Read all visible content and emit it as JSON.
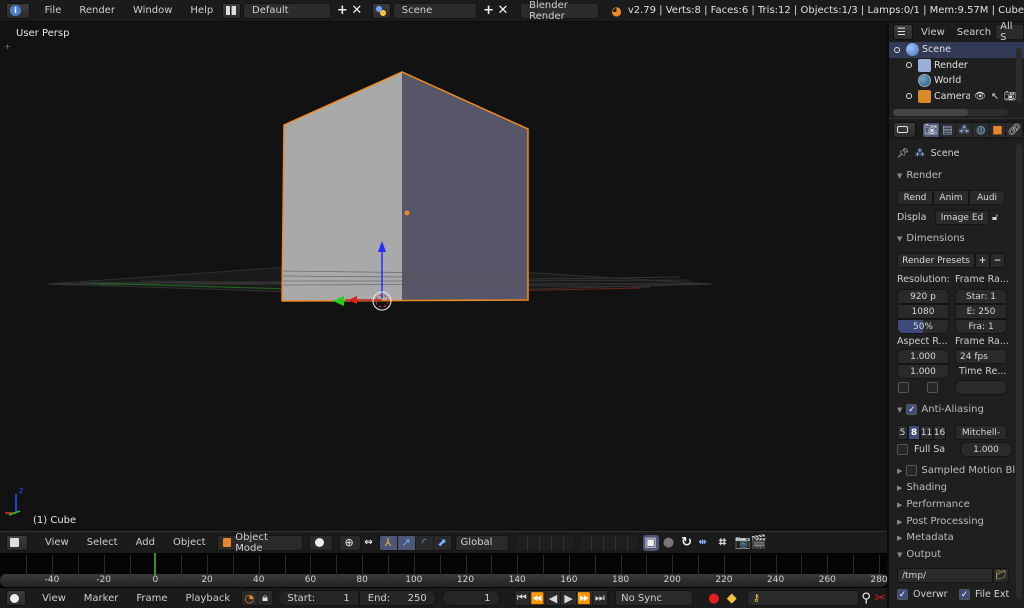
{
  "topbar": {
    "menus": [
      "File",
      "Render",
      "Window",
      "Help"
    ],
    "screen_layout": "Default",
    "scene": "Scene",
    "render_engine": "Blender Render",
    "stats": "v2.79 | Verts:8 | Faces:6 | Tris:12 | Objects:1/3 | Lamps:0/1 | Mem:9.57M | Cube"
  },
  "viewport": {
    "view_label": "User Persp",
    "object_label": "(1) Cube",
    "axis_z": "z",
    "axis_y": "y",
    "colors": {
      "selection_outline": "#f08a24",
      "background": "#121212"
    }
  },
  "view3d_header": {
    "menus": [
      "View",
      "Select",
      "Add",
      "Object"
    ],
    "mode": "Object Mode",
    "orientation": "Global"
  },
  "timeline": {
    "ticks": [
      "-40",
      "-20",
      "0",
      "20",
      "40",
      "60",
      "80",
      "100",
      "120",
      "140",
      "160",
      "180",
      "200",
      "220",
      "240",
      "260",
      "280"
    ],
    "current_frame_marker": "0",
    "menus": [
      "View",
      "Marker",
      "Frame",
      "Playback"
    ],
    "start_label": "Start:",
    "start_value": "1",
    "end_label": "End:",
    "end_value": "250",
    "current_frame": "1",
    "sync": "No Sync"
  },
  "outliner": {
    "header_menus": [
      "View",
      "Search",
      "All S"
    ],
    "items": [
      {
        "label": "Scene",
        "icon": "scene-icon",
        "selected": true
      },
      {
        "label": "Render",
        "icon": "render-layers-icon"
      },
      {
        "label": "World",
        "icon": "world-icon"
      },
      {
        "label": "Camera",
        "icon": "camera-icon"
      }
    ]
  },
  "properties": {
    "breadcrumb": "Scene",
    "render_panel": {
      "title": "Render",
      "buttons": [
        "Rend",
        "Anim",
        "Audi"
      ],
      "display_label": "Displa",
      "display_value": "Image Ed"
    },
    "dimensions_panel": {
      "title": "Dimensions",
      "presets": "Render Presets",
      "resolution_label": "Resolution:",
      "res_x": "920 p",
      "res_y": "1080",
      "res_pct": "50%",
      "res_pct_fraction": 0.5,
      "frame_range_label": "Frame Ra...",
      "frame_start": "Star: 1",
      "frame_end": "E: 250",
      "frame_step": "Fra:  1",
      "aspect_label": "Aspect R...",
      "aspect_x": "1.000",
      "aspect_y": "1.000",
      "frame_rate_label": "Frame Ra...",
      "frame_rate": "24 fps",
      "time_remap_label": "Time Re..."
    },
    "aa_panel": {
      "title": "Anti-Aliasing",
      "samples": [
        "5",
        "8",
        "11",
        "16"
      ],
      "selected_sample": "8",
      "filter": "Mitchell-",
      "full_sample": "Full Sa",
      "filter_size": "1.000"
    },
    "collapsed_panels": [
      "Sampled Motion Blu",
      "Shading",
      "Performance",
      "Post Processing",
      "Metadata"
    ],
    "output_panel": {
      "title": "Output",
      "path": "/tmp/",
      "overwrite": "Overwr",
      "file_ext": "File Ext"
    }
  }
}
